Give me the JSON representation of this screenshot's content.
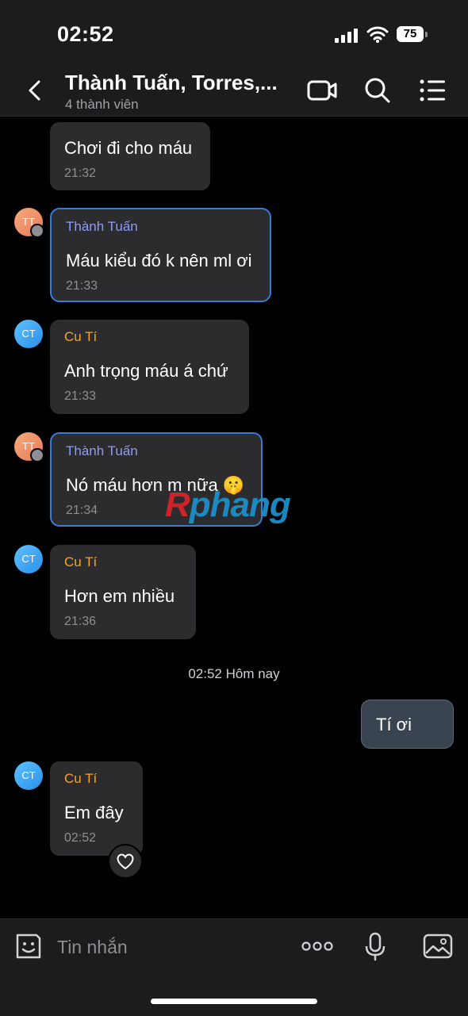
{
  "status": {
    "time": "02:52",
    "battery": "75"
  },
  "header": {
    "title": "Thành Tuấn, Torres,...",
    "subtitle": "4 thành viên"
  },
  "messages": [
    {
      "sender": "",
      "text": "Chơi đi cho máu",
      "time": "21:32"
    },
    {
      "avatar": "TT",
      "sender": "Thành Tuấn",
      "text": "Máu kiểu đó k nên ml ơi",
      "time": "21:33"
    },
    {
      "avatar": "CT",
      "sender": "Cu Tí",
      "text": "Anh trọng máu á chứ",
      "time": "21:33"
    },
    {
      "avatar": "TT",
      "sender": "Thành Tuấn",
      "text": "Nó máu hơn m nữa 🤫",
      "time": "21:34"
    },
    {
      "avatar": "CT",
      "sender": "Cu Tí",
      "text": "Hơn em nhiều",
      "time": "21:36"
    },
    {
      "avatar": "CT",
      "sender": "Cu Tí",
      "text": "Em đây",
      "time": "02:52"
    }
  ],
  "day_separator": "02:52 Hôm nay",
  "outgoing": {
    "text": "Tí ơi"
  },
  "watermark": {
    "first": "R",
    "rest": "phang"
  },
  "input": {
    "placeholder": "Tin nhắn"
  },
  "colors": {
    "accent": "#3a7bd5",
    "tt_name": "#8e9cf5",
    "ct_name": "#f5a623",
    "bubble": "#2c2c2e"
  },
  "icons": [
    "back-icon",
    "video-call-icon",
    "search-icon",
    "menu-icon",
    "sticker-icon",
    "more-icon",
    "mic-icon",
    "image-icon",
    "heart-icon"
  ]
}
